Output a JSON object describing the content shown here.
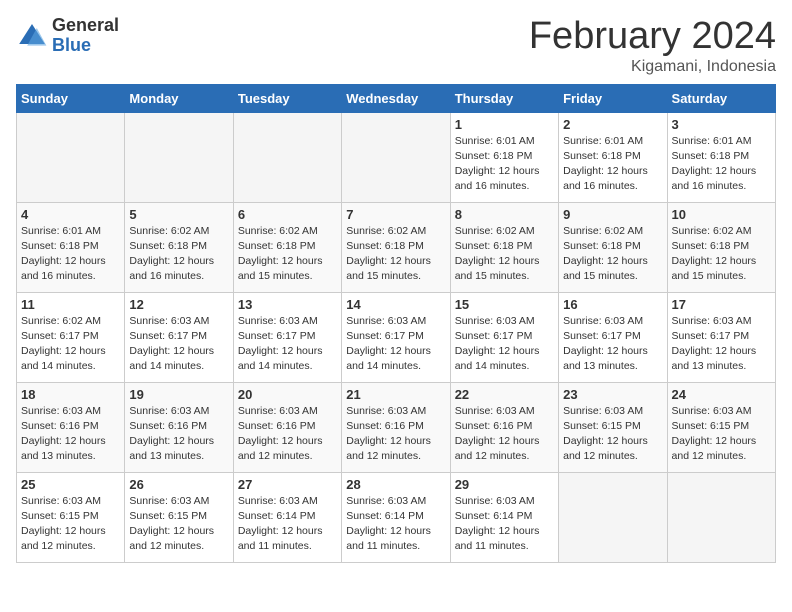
{
  "header": {
    "logo_general": "General",
    "logo_blue": "Blue",
    "month_title": "February 2024",
    "location": "Kigamani, Indonesia"
  },
  "days_of_week": [
    "Sunday",
    "Monday",
    "Tuesday",
    "Wednesday",
    "Thursday",
    "Friday",
    "Saturday"
  ],
  "weeks": [
    [
      {
        "day": "",
        "info": ""
      },
      {
        "day": "",
        "info": ""
      },
      {
        "day": "",
        "info": ""
      },
      {
        "day": "",
        "info": ""
      },
      {
        "day": "1",
        "info": "Sunrise: 6:01 AM\nSunset: 6:18 PM\nDaylight: 12 hours\nand 16 minutes."
      },
      {
        "day": "2",
        "info": "Sunrise: 6:01 AM\nSunset: 6:18 PM\nDaylight: 12 hours\nand 16 minutes."
      },
      {
        "day": "3",
        "info": "Sunrise: 6:01 AM\nSunset: 6:18 PM\nDaylight: 12 hours\nand 16 minutes."
      }
    ],
    [
      {
        "day": "4",
        "info": "Sunrise: 6:01 AM\nSunset: 6:18 PM\nDaylight: 12 hours\nand 16 minutes."
      },
      {
        "day": "5",
        "info": "Sunrise: 6:02 AM\nSunset: 6:18 PM\nDaylight: 12 hours\nand 16 minutes."
      },
      {
        "day": "6",
        "info": "Sunrise: 6:02 AM\nSunset: 6:18 PM\nDaylight: 12 hours\nand 15 minutes."
      },
      {
        "day": "7",
        "info": "Sunrise: 6:02 AM\nSunset: 6:18 PM\nDaylight: 12 hours\nand 15 minutes."
      },
      {
        "day": "8",
        "info": "Sunrise: 6:02 AM\nSunset: 6:18 PM\nDaylight: 12 hours\nand 15 minutes."
      },
      {
        "day": "9",
        "info": "Sunrise: 6:02 AM\nSunset: 6:18 PM\nDaylight: 12 hours\nand 15 minutes."
      },
      {
        "day": "10",
        "info": "Sunrise: 6:02 AM\nSunset: 6:18 PM\nDaylight: 12 hours\nand 15 minutes."
      }
    ],
    [
      {
        "day": "11",
        "info": "Sunrise: 6:02 AM\nSunset: 6:17 PM\nDaylight: 12 hours\nand 14 minutes."
      },
      {
        "day": "12",
        "info": "Sunrise: 6:03 AM\nSunset: 6:17 PM\nDaylight: 12 hours\nand 14 minutes."
      },
      {
        "day": "13",
        "info": "Sunrise: 6:03 AM\nSunset: 6:17 PM\nDaylight: 12 hours\nand 14 minutes."
      },
      {
        "day": "14",
        "info": "Sunrise: 6:03 AM\nSunset: 6:17 PM\nDaylight: 12 hours\nand 14 minutes."
      },
      {
        "day": "15",
        "info": "Sunrise: 6:03 AM\nSunset: 6:17 PM\nDaylight: 12 hours\nand 14 minutes."
      },
      {
        "day": "16",
        "info": "Sunrise: 6:03 AM\nSunset: 6:17 PM\nDaylight: 12 hours\nand 13 minutes."
      },
      {
        "day": "17",
        "info": "Sunrise: 6:03 AM\nSunset: 6:17 PM\nDaylight: 12 hours\nand 13 minutes."
      }
    ],
    [
      {
        "day": "18",
        "info": "Sunrise: 6:03 AM\nSunset: 6:16 PM\nDaylight: 12 hours\nand 13 minutes."
      },
      {
        "day": "19",
        "info": "Sunrise: 6:03 AM\nSunset: 6:16 PM\nDaylight: 12 hours\nand 13 minutes."
      },
      {
        "day": "20",
        "info": "Sunrise: 6:03 AM\nSunset: 6:16 PM\nDaylight: 12 hours\nand 12 minutes."
      },
      {
        "day": "21",
        "info": "Sunrise: 6:03 AM\nSunset: 6:16 PM\nDaylight: 12 hours\nand 12 minutes."
      },
      {
        "day": "22",
        "info": "Sunrise: 6:03 AM\nSunset: 6:16 PM\nDaylight: 12 hours\nand 12 minutes."
      },
      {
        "day": "23",
        "info": "Sunrise: 6:03 AM\nSunset: 6:15 PM\nDaylight: 12 hours\nand 12 minutes."
      },
      {
        "day": "24",
        "info": "Sunrise: 6:03 AM\nSunset: 6:15 PM\nDaylight: 12 hours\nand 12 minutes."
      }
    ],
    [
      {
        "day": "25",
        "info": "Sunrise: 6:03 AM\nSunset: 6:15 PM\nDaylight: 12 hours\nand 12 minutes."
      },
      {
        "day": "26",
        "info": "Sunrise: 6:03 AM\nSunset: 6:15 PM\nDaylight: 12 hours\nand 12 minutes."
      },
      {
        "day": "27",
        "info": "Sunrise: 6:03 AM\nSunset: 6:14 PM\nDaylight: 12 hours\nand 11 minutes."
      },
      {
        "day": "28",
        "info": "Sunrise: 6:03 AM\nSunset: 6:14 PM\nDaylight: 12 hours\nand 11 minutes."
      },
      {
        "day": "29",
        "info": "Sunrise: 6:03 AM\nSunset: 6:14 PM\nDaylight: 12 hours\nand 11 minutes."
      },
      {
        "day": "",
        "info": ""
      },
      {
        "day": "",
        "info": ""
      }
    ]
  ]
}
